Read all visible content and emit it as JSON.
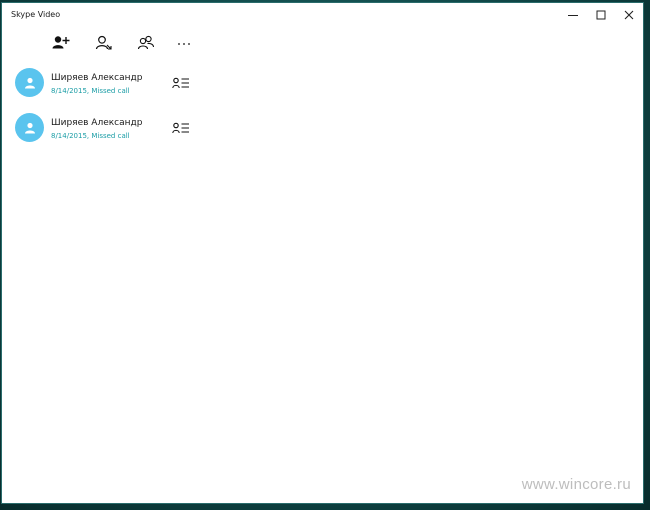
{
  "window": {
    "title": "Skype Video"
  },
  "toolbar": {
    "buttons": [
      {
        "name": "add-contact",
        "icon": "person-add-icon"
      },
      {
        "name": "new-call",
        "icon": "person-call-icon"
      },
      {
        "name": "group",
        "icon": "people-icon"
      },
      {
        "name": "more",
        "icon": "ellipsis-icon"
      }
    ]
  },
  "calls": [
    {
      "name": "Ширяев Александр",
      "detail": "8/14/2015, Missed call"
    },
    {
      "name": "Ширяев Александр",
      "detail": "8/14/2015, Missed call"
    }
  ],
  "watermark": "www.wincore.ru",
  "colors": {
    "avatar": "#5ac4ee",
    "detail_text": "#1b9da6",
    "desktop": "#0f4646"
  }
}
